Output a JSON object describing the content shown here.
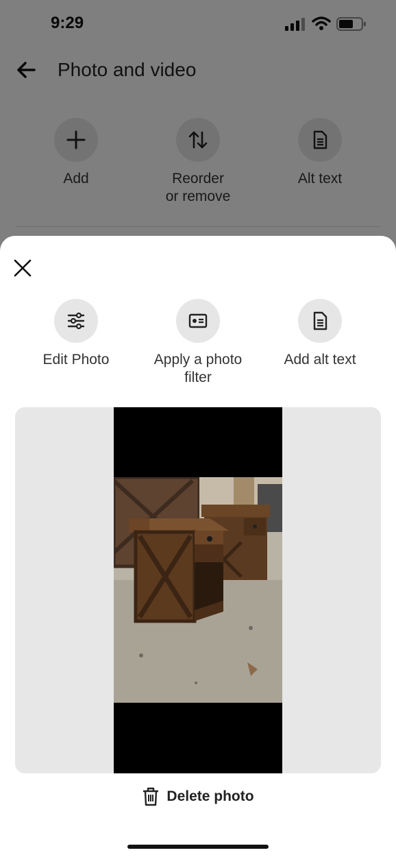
{
  "status": {
    "time": "9:29"
  },
  "header": {
    "title": "Photo and video"
  },
  "actions": [
    {
      "label": "Add",
      "icon": "plus-icon"
    },
    {
      "label": "Reorder\nor remove",
      "icon": "reorder-icon"
    },
    {
      "label": "Alt text",
      "icon": "document-icon"
    }
  ],
  "sheet": {
    "actions": [
      {
        "label": "Edit Photo",
        "icon": "sliders-icon"
      },
      {
        "label": "Apply a photo\nfilter",
        "icon": "filter-icon"
      },
      {
        "label": "Add alt text",
        "icon": "document-icon"
      }
    ],
    "delete_label": "Delete photo"
  },
  "colors": {
    "overlay": "#000000",
    "circle_bg": "#e6e6e6",
    "frame_bg": "#e7e7e7"
  }
}
